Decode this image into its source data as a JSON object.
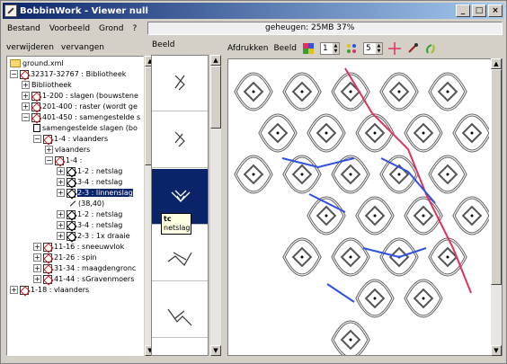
{
  "window": {
    "title": "BobbinWork - Viewer null"
  },
  "menu": [
    "Bestand",
    "Voorbeeld",
    "Grond",
    "?"
  ],
  "status": "geheugen: 25MB 37%",
  "tree_toolbar": {
    "remove": "verwijderen",
    "replace": "vervangen"
  },
  "tree": [
    {
      "text": "ground.xml",
      "icon": "folder"
    },
    {
      "text": "32317-32767 : Bibliotheek",
      "icon": "red"
    },
    {
      "text": "Bibliotheek",
      "icon": "book"
    },
    {
      "text": "1-200 : slagen (bouwstene",
      "icon": "red"
    },
    {
      "text": "201-400 : raster (wordt ge",
      "icon": "red"
    },
    {
      "text": "401-450 : samengestelde s",
      "icon": "red"
    },
    {
      "text": "samengestelde slagen (bo",
      "icon": "book"
    },
    {
      "text": "1-4 : vlaanders",
      "icon": "red"
    },
    {
      "text": "vlaanders",
      "icon": "book"
    },
    {
      "text": "1-4 :",
      "icon": "red"
    },
    {
      "text": "1-2 : netslag",
      "icon": "black"
    },
    {
      "text": "3-4 : netslag",
      "icon": "black"
    },
    {
      "text": "2-3 : linnenslag",
      "icon": "black"
    },
    {
      "text": "(38,40)",
      "icon": "pin"
    },
    {
      "text": "1-2 : netslag",
      "icon": "black"
    },
    {
      "text": "3-4 : netslag",
      "icon": "black"
    },
    {
      "text": "2-3 : 1x draaie",
      "icon": "black"
    },
    {
      "text": "11-16 : sneeuwvlok",
      "icon": "red"
    },
    {
      "text": "21-26 : spin",
      "icon": "red"
    },
    {
      "text": "31-34 : maagdengronc",
      "icon": "red"
    },
    {
      "text": "41-44 : sGravenmoers",
      "icon": "red"
    },
    {
      "text": "1-18 : vlaanders",
      "icon": "red"
    }
  ],
  "thumb_tab": "Beeld",
  "tooltip": {
    "title": "tc",
    "text": "netslag"
  },
  "right_toolbar": {
    "print": "Afdrukken",
    "view": "Beeld",
    "spin1": "1",
    "spin2": "5"
  },
  "colors": {
    "thread_red": "#e03060",
    "thread_blue": "#3050e0",
    "selection": "#0a246a",
    "title_start": "#0a246a",
    "title_end": "#a6caf0"
  }
}
